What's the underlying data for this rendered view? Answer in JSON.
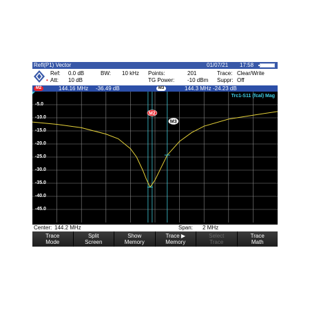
{
  "title": "Refl(P1) Vector",
  "date": "01/07/21",
  "time": "17:58",
  "info": {
    "ref_label": "Ref:",
    "ref_value": "0.0 dB",
    "att_label": "Att:",
    "att_value": "10 dB",
    "bw_label": "BW:",
    "bw_value": "10 kHz",
    "points_label": "Points:",
    "points_value": "201",
    "tg_label": "TG Power:",
    "tg_value": "-10 dBm",
    "trace_label": "Trace:",
    "trace_value": "Clear/Write",
    "suppr_label": "Suppr:",
    "suppr_value": "Off"
  },
  "markers": {
    "m2": {
      "badge": "M2",
      "freq": "144.16 MHz",
      "level": "-36.49 dB"
    },
    "m3": {
      "badge": "M3",
      "freq": "144.3 MHz",
      "level": "-24.23 dB"
    }
  },
  "trace_label": "Trc1-S11 (fcal) Mag",
  "y_ticks": [
    "-5.0",
    "-10.0",
    "-15.0",
    "-20.0",
    "-25.0",
    "-30.0",
    "-35.0",
    "-40.0",
    "-45.0"
  ],
  "center_label": "Center:",
  "center_value": "144.2 MHz",
  "span_label": "Span:",
  "span_value": "2 MHz",
  "softkeys": [
    {
      "l1": "Trace",
      "l2": "Mode",
      "enabled": true
    },
    {
      "l1": "Split",
      "l2": "Screen",
      "enabled": true
    },
    {
      "l1": "Show",
      "l2": "Memory",
      "enabled": true
    },
    {
      "l1": "Trace ▶",
      "l2": "Memory",
      "enabled": true
    },
    {
      "l1": "Select",
      "l2": "Trace",
      "enabled": false
    },
    {
      "l1": "Trace",
      "l2": "Math",
      "enabled": true
    }
  ],
  "colors": {
    "trace": "#e6d23a",
    "marker_line": "#3fc8d8",
    "m2_badge": "#e8232b",
    "m3_badge": "#ffffff",
    "grid": "#8a8a8a"
  },
  "chart_data": {
    "type": "line",
    "xlabel": "",
    "ylabel": "",
    "xlim": [
      143.2,
      145.2
    ],
    "ylim": [
      -50,
      0
    ],
    "x": [
      143.2,
      143.4,
      143.6,
      143.8,
      143.9,
      144.0,
      144.05,
      144.1,
      144.13,
      144.16,
      144.2,
      144.25,
      144.3,
      144.4,
      144.5,
      144.6,
      144.8,
      145.0,
      145.2
    ],
    "values": [
      -11.6,
      -12.5,
      -13.8,
      -16.2,
      -18.0,
      -21.8,
      -25.0,
      -30.0,
      -33.5,
      -36.49,
      -33.8,
      -29.0,
      -24.23,
      -19.0,
      -15.6,
      -13.2,
      -10.5,
      -9.0,
      -7.6
    ]
  }
}
